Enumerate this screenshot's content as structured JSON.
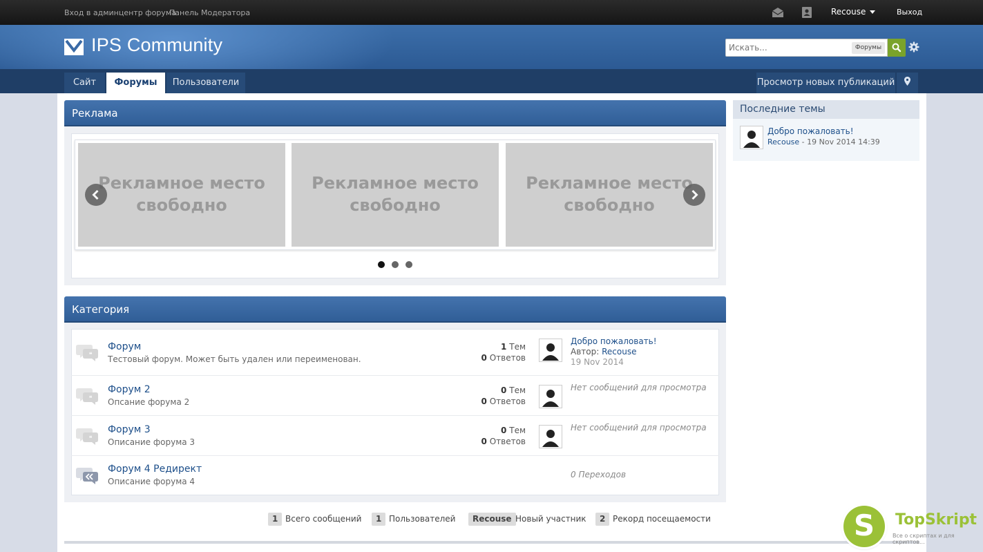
{
  "topbar": {
    "admin_link": "Вход в админцентр форума",
    "mod_link": "Панель Модератора",
    "username": "Recouse",
    "logout": "Выход"
  },
  "header": {
    "logo_text": "IPS Community",
    "search_placeholder": "Искать...",
    "search_scope": "Форумы"
  },
  "nav": {
    "tabs": [
      {
        "label": "Сайт"
      },
      {
        "label": "Форумы"
      },
      {
        "label": "Пользователи"
      }
    ],
    "active_tab": "Форумы",
    "new_content": "Просмотр новых публикаций"
  },
  "ads": {
    "title": "Реклама",
    "slots": [
      {
        "line1": "Рекламное место",
        "line2": "свободно"
      },
      {
        "line1": "Рекламное место",
        "line2": "свободно"
      },
      {
        "line1": "Рекламное место",
        "line2": "свободно"
      }
    ],
    "active_dot": 1,
    "dot_count": 3
  },
  "category": {
    "title": "Категория",
    "forums": [
      {
        "title": "Форум",
        "desc": "Тестовый форум. Может быть удален или переименован.",
        "topics": "1",
        "topics_label": "Тем",
        "replies": "0",
        "replies_label": "Ответов",
        "last_title": "Добро пожаловать!",
        "last_author_label": "Автор:",
        "last_author": "Recouse",
        "last_date": "19 Nov 2014"
      },
      {
        "title": "Форум 2",
        "desc": "Опсание форума 2",
        "topics": "0",
        "topics_label": "Тем",
        "replies": "0",
        "replies_label": "Ответов",
        "empty": "Нет сообщений для просмотра"
      },
      {
        "title": "Форум 3",
        "desc": "Описание форума 3",
        "topics": "0",
        "topics_label": "Тем",
        "replies": "0",
        "replies_label": "Ответов",
        "empty": "Нет сообщений для просмотра"
      },
      {
        "title": "Форум 4 Редирект",
        "desc": "Описание форума 4",
        "redirects": "0 Переходов"
      }
    ]
  },
  "stats": {
    "total_posts": "1",
    "total_posts_label": "Всего сообщений",
    "members": "1",
    "members_label": "Пользователей",
    "newest": "Recouse",
    "newest_label": "Новый участник",
    "record": "2",
    "record_label": "Рекорд посещаемости"
  },
  "sidebar": {
    "title": "Последние темы",
    "topic_title": "Добро пожаловать!",
    "topic_author": "Recouse",
    "topic_date": " - 19 Nov 2014 14:39"
  },
  "watermark": {
    "letter": "S",
    "name": "TopSkript",
    "tagline": "Все о скриптах и для скриптов..."
  },
  "colors": {
    "accent": "#2f5d96",
    "search_button": "#7aa32b",
    "link": "#1d4f8a"
  }
}
